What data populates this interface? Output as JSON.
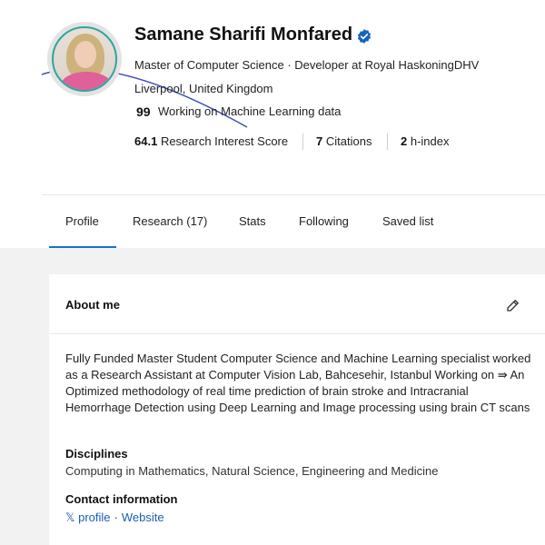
{
  "profile": {
    "name": "Samane Sharifi Monfared",
    "headline": "Master of Computer Science · Developer at Royal HaskoningDHV",
    "location": "Liverpool, United Kingdom",
    "status_icon": "quote-icon",
    "status_icon_glyph": "99",
    "status": "Working on Machine Learning data"
  },
  "stats": {
    "score_value": "64.1",
    "score_label": "Research Interest Score",
    "citations_value": "7",
    "citations_label": "Citations",
    "hindex_value": "2",
    "hindex_label": "h-index"
  },
  "tabs": [
    {
      "label": "Profile",
      "active": true
    },
    {
      "label": "Research (17)",
      "active": false
    },
    {
      "label": "Stats",
      "active": false
    },
    {
      "label": "Following",
      "active": false
    },
    {
      "label": "Saved list",
      "active": false
    }
  ],
  "about": {
    "title": "About me",
    "text": "Fully Funded Master Student Computer Science and Machine Learning specialist worked as a Research Assistant at Computer Vision Lab, Bahcesehir, Istanbul Working on ⇛ An Optimized methodology of real time prediction of brain stroke and Intracranial Hemorrhage Detection using Deep Learning and Image processing using brain CT scans",
    "disciplines_title": "Disciplines",
    "disciplines": "Computing in Mathematics, Natural Science, Engineering and Medicine",
    "contact_title": "Contact information",
    "contact_x_label": "𝕏 profile",
    "contact_sep": "·",
    "contact_website_label": "Website"
  },
  "colors": {
    "accent": "#1a73c9",
    "verified": "#1565c0",
    "link": "#1a5fb4",
    "avatar_ring": "#2ea6a0"
  }
}
